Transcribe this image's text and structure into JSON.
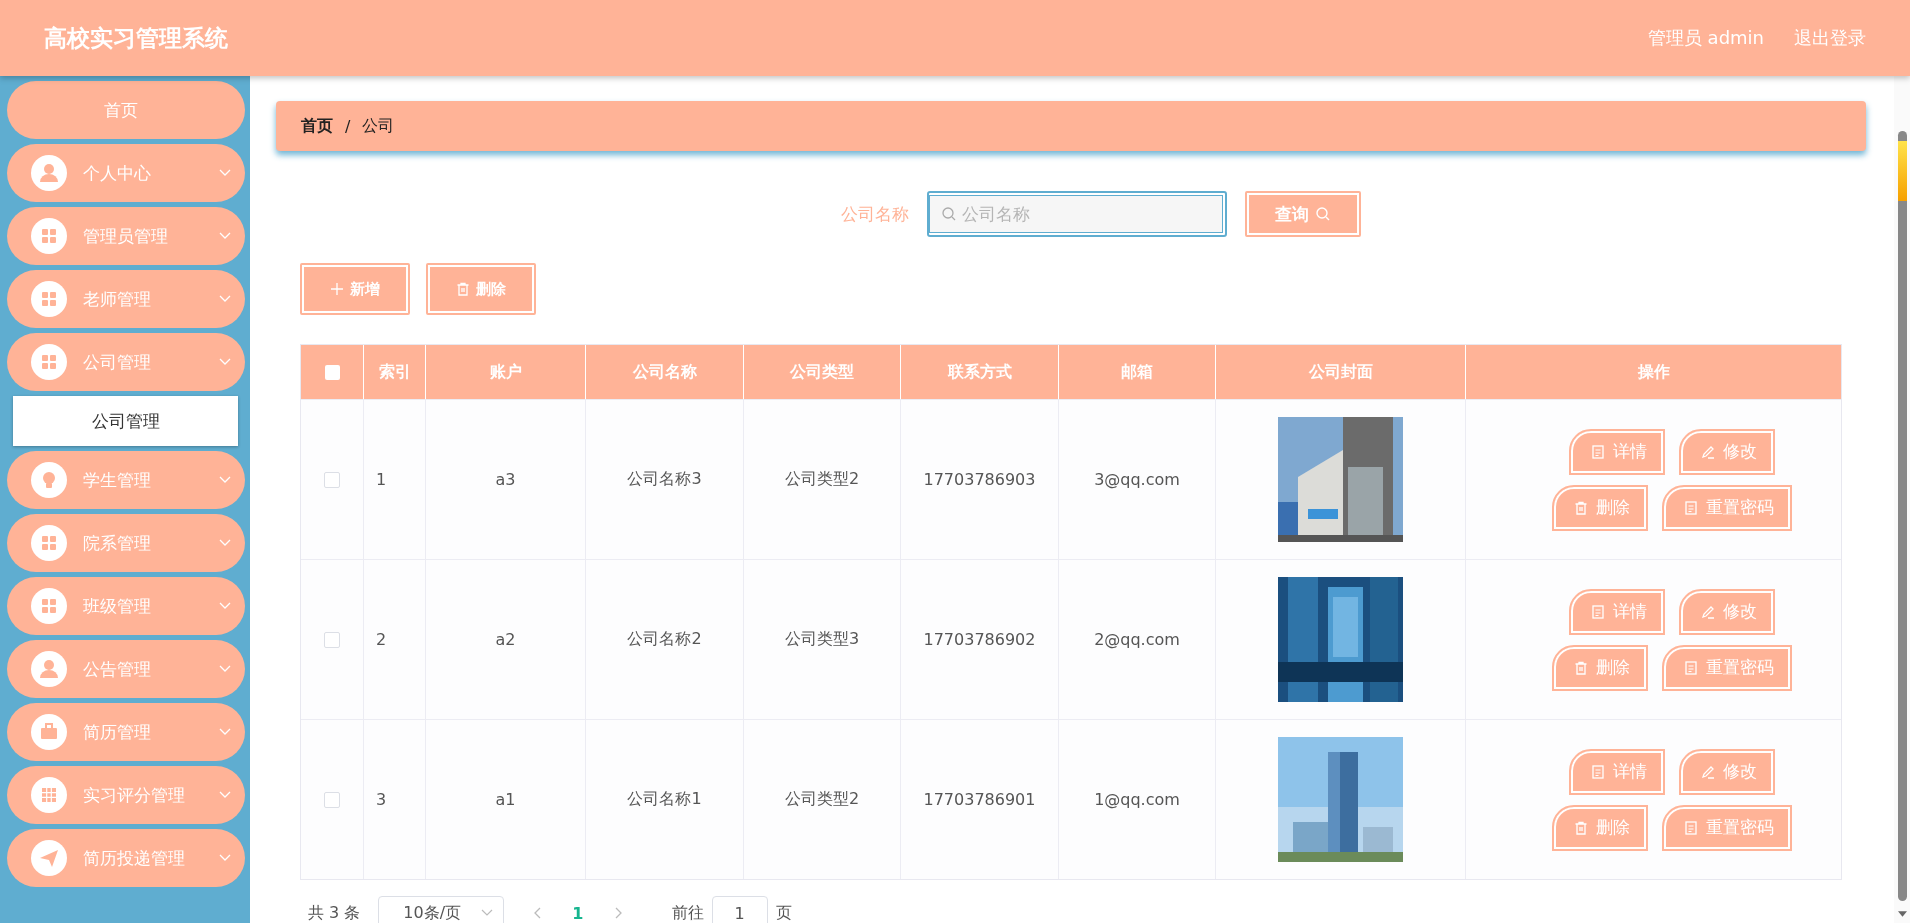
{
  "header": {
    "title": "高校实习管理系统",
    "user": "管理员 admin",
    "logout": "退出登录"
  },
  "sidebar": {
    "items": [
      {
        "label": "首页",
        "kind": "home"
      },
      {
        "label": "个人中心",
        "kind": "person"
      },
      {
        "label": "管理员管理",
        "kind": "grid"
      },
      {
        "label": "老师管理",
        "kind": "grid"
      },
      {
        "label": "公司管理",
        "kind": "grid",
        "children": [
          {
            "label": "公司管理",
            "selected": true
          }
        ]
      },
      {
        "label": "学生管理",
        "kind": "bulb"
      },
      {
        "label": "院系管理",
        "kind": "grid"
      },
      {
        "label": "班级管理",
        "kind": "grid"
      },
      {
        "label": "公告管理",
        "kind": "person"
      },
      {
        "label": "简历管理",
        "kind": "case"
      },
      {
        "label": "实习评分管理",
        "kind": "table"
      },
      {
        "label": "简历投递管理",
        "kind": "send"
      }
    ]
  },
  "breadcrumb": {
    "items": [
      "首页",
      "公司"
    ],
    "separator": "/"
  },
  "search": {
    "label": "公司名称",
    "placeholder": "公司名称",
    "button": "查询"
  },
  "toolbar": {
    "add": "新增",
    "delete": "删除"
  },
  "table": {
    "columns": [
      "索引",
      "账户",
      "公司名称",
      "公司类型",
      "联系方式",
      "邮箱",
      "公司封面",
      "操作"
    ],
    "header_checked": false,
    "rows": [
      {
        "checked": false,
        "cells": [
          "1",
          "a3",
          "公司名称3",
          "公司类型2",
          "17703786903",
          "3@qq.com"
        ],
        "actions": [
          "详情",
          "修改",
          "删除",
          "重置密码"
        ]
      },
      {
        "checked": false,
        "cells": [
          "2",
          "a2",
          "公司名称2",
          "公司类型3",
          "17703786902",
          "2@qq.com"
        ],
        "actions": [
          "详情",
          "修改",
          "删除",
          "重置密码"
        ]
      },
      {
        "checked": false,
        "cells": [
          "3",
          "a1",
          "公司名称1",
          "公司类型2",
          "17703786901",
          "1@qq.com"
        ],
        "actions": [
          "详情",
          "修改",
          "删除",
          "重置密码"
        ]
      }
    ]
  },
  "pagination": {
    "total": "共 3 条",
    "page_size": "10条/页",
    "pages": [
      {
        "label": "1",
        "selected": true
      }
    ],
    "goto_label": "前往",
    "goto_value": "1",
    "goto_suffix": "页"
  }
}
